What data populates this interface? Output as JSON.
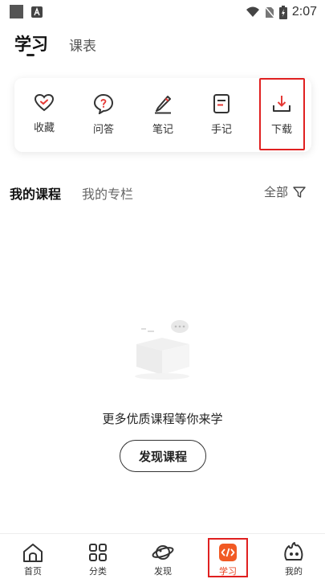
{
  "status_bar": {
    "time": "2:07",
    "icons": [
      "app-square-icon",
      "a-badge-icon",
      "wifi-icon",
      "no-sim-icon",
      "battery-charging-icon"
    ]
  },
  "top_tabs": [
    {
      "label": "学习",
      "active": true
    },
    {
      "label": "课表",
      "active": false
    }
  ],
  "quick_actions": [
    {
      "label": "收藏",
      "icon": "heart-check-icon"
    },
    {
      "label": "问答",
      "icon": "question-bubble-icon"
    },
    {
      "label": "笔记",
      "icon": "pencil-icon"
    },
    {
      "label": "手记",
      "icon": "document-icon"
    },
    {
      "label": "下载",
      "icon": "download-icon",
      "highlighted": true
    }
  ],
  "course_tabs": [
    {
      "label": "我的课程",
      "active": true
    },
    {
      "label": "我的专栏",
      "active": false
    }
  ],
  "filter": {
    "label": "全部",
    "icon": "filter-icon"
  },
  "empty_state": {
    "message": "更多优质课程等你来学",
    "button_label": "发现课程",
    "illustration": "empty-box-icon"
  },
  "bottom_nav": [
    {
      "label": "首页",
      "icon": "home-icon"
    },
    {
      "label": "分类",
      "icon": "grid-icon"
    },
    {
      "label": "发现",
      "icon": "planet-icon"
    },
    {
      "label": "学习",
      "icon": "code-icon",
      "active": true
    },
    {
      "label": "我的",
      "icon": "mascot-icon"
    }
  ],
  "colors": {
    "accent": "#e8401c",
    "highlight_border": "#e02020",
    "text_primary": "#222222",
    "icon_red": "#e53935"
  }
}
